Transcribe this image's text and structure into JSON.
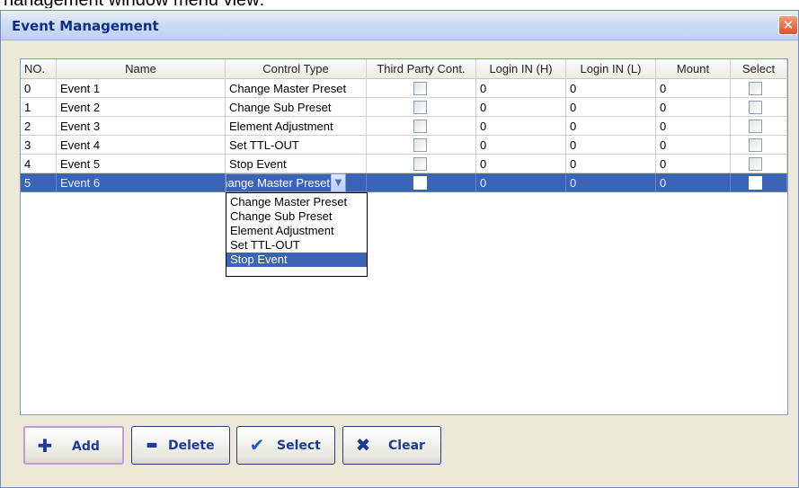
{
  "caption": "nanagement window menu view:",
  "window": {
    "title": "Event Management",
    "close_symbol": "✕"
  },
  "table": {
    "headers": [
      "NO.",
      "Name",
      "Control Type",
      "Third Party Cont.",
      "Login IN (H)",
      "Login IN (L)",
      "Mount",
      "Select"
    ],
    "rows": [
      {
        "no": "0",
        "name": "Event 1",
        "control_type": "Change Master Preset",
        "login_h": "0",
        "login_l": "0",
        "mount": "0"
      },
      {
        "no": "1",
        "name": "Event 2",
        "control_type": "Change Sub Preset",
        "login_h": "0",
        "login_l": "0",
        "mount": "0"
      },
      {
        "no": "2",
        "name": "Event 3",
        "control_type": "Element Adjustment",
        "login_h": "0",
        "login_l": "0",
        "mount": "0"
      },
      {
        "no": "3",
        "name": "Event 4",
        "control_type": "Set TTL-OUT",
        "login_h": "0",
        "login_l": "0",
        "mount": "0"
      },
      {
        "no": "4",
        "name": "Event 5",
        "control_type": "Stop Event",
        "login_h": "0",
        "login_l": "0",
        "mount": "0"
      },
      {
        "no": "5",
        "name": "Event 6",
        "control_type": "Change Master Preset",
        "login_h": "0",
        "login_l": "0",
        "mount": "0"
      }
    ],
    "dropdown_options": [
      "Change Master Preset",
      "Change Sub Preset",
      "Element Adjustment",
      "Set TTL-OUT",
      "Stop Event"
    ],
    "dropdown_highlighted": "Stop Event"
  },
  "buttons": {
    "add": {
      "label": "Add",
      "icon": "plus-icon",
      "glyph": "✚"
    },
    "delete": {
      "label": "Delete",
      "icon": "minus-icon",
      "glyph": "▬"
    },
    "select": {
      "label": "Select",
      "icon": "checkmark-icon",
      "glyph": "✔"
    },
    "clear": {
      "label": "Clear",
      "icon": "x-icon",
      "glyph": "✖"
    }
  },
  "colors": {
    "selection": "#3b64b6",
    "title_text": "#0b2f86",
    "button_text": "#1b3a9a",
    "close_button": "#d8542c"
  }
}
